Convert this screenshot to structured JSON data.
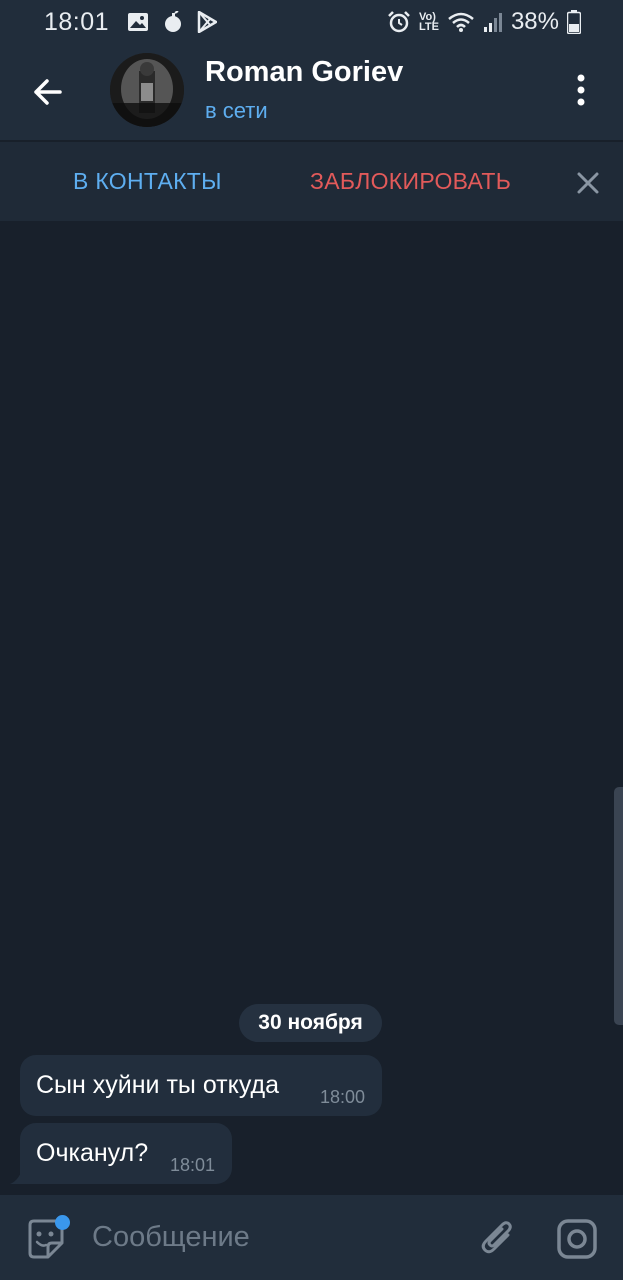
{
  "status_bar": {
    "time": "18:01",
    "battery_percent": "38%",
    "left_icons": [
      "image-icon",
      "bomb-icon",
      "play-store-icon"
    ],
    "right_icons": [
      "alarm-icon",
      "volte-icon",
      "wifi-icon",
      "signal-icon",
      "battery-icon"
    ],
    "volte_label_top": "Vo)",
    "volte_label_bottom": "LTE"
  },
  "header": {
    "contact_name": "Roman Goriev",
    "contact_status": "в сети"
  },
  "action_bar": {
    "add_contact_label": "В КОНТАКТЫ",
    "block_label": "ЗАБЛОКИРОВАТЬ"
  },
  "chat": {
    "date_label": "30 ноября",
    "messages": [
      {
        "text": "Сын хуйни ты откуда",
        "time": "18:00"
      },
      {
        "text": "Очканул?",
        "time": "18:01"
      }
    ]
  },
  "input": {
    "placeholder": "Сообщение",
    "value": ""
  },
  "colors": {
    "background": "#18202b",
    "header": "#212d3b",
    "bubble": "#222e3d",
    "accent_blue": "#5eaef0",
    "danger_red": "#e25a5a"
  }
}
